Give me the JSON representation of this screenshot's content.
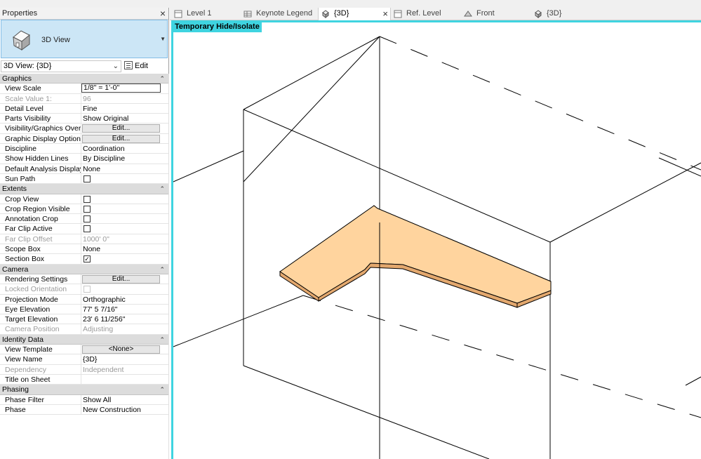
{
  "panel": {
    "title": "Properties",
    "close": "×",
    "type_name": "3D View",
    "view_selector": "3D View: {3D}",
    "edit_type": "Edit Type"
  },
  "groups": [
    {
      "label": "Graphics",
      "rows": [
        {
          "name": "View Scale",
          "value": "1/8\" = 1'-0\"",
          "kind": "boxed"
        },
        {
          "name": "Scale Value    1:",
          "value": "96",
          "kind": "dim"
        },
        {
          "name": "Detail Level",
          "value": "Fine"
        },
        {
          "name": "Parts Visibility",
          "value": "Show Original"
        },
        {
          "name": "Visibility/Graphics Over...",
          "value": "Edit...",
          "kind": "button"
        },
        {
          "name": "Graphic Display Options",
          "value": "Edit...",
          "kind": "button"
        },
        {
          "name": "Discipline",
          "value": "Coordination"
        },
        {
          "name": "Show Hidden Lines",
          "value": "By Discipline"
        },
        {
          "name": "Default Analysis Display...",
          "value": "None"
        },
        {
          "name": "Sun Path",
          "value": "",
          "kind": "checkbox",
          "checked": false
        }
      ]
    },
    {
      "label": "Extents",
      "rows": [
        {
          "name": "Crop View",
          "value": "",
          "kind": "checkbox",
          "checked": false
        },
        {
          "name": "Crop Region Visible",
          "value": "",
          "kind": "checkbox",
          "checked": false
        },
        {
          "name": "Annotation Crop",
          "value": "",
          "kind": "checkbox",
          "checked": false
        },
        {
          "name": "Far Clip Active",
          "value": "",
          "kind": "checkbox",
          "checked": false
        },
        {
          "name": "Far Clip Offset",
          "value": "1000'  0\"",
          "kind": "dim"
        },
        {
          "name": "Scope Box",
          "value": "None"
        },
        {
          "name": "Section Box",
          "value": "",
          "kind": "checkbox",
          "checked": true
        }
      ]
    },
    {
      "label": "Camera",
      "rows": [
        {
          "name": "Rendering Settings",
          "value": "Edit...",
          "kind": "button"
        },
        {
          "name": "Locked Orientation",
          "value": "",
          "kind": "checkbox-dim",
          "checked": false
        },
        {
          "name": "Projection Mode",
          "value": "Orthographic"
        },
        {
          "name": "Eye Elevation",
          "value": "77'  5 7/16\""
        },
        {
          "name": "Target Elevation",
          "value": "23'  6 11/256\""
        },
        {
          "name": "Camera Position",
          "value": "Adjusting",
          "kind": "dim"
        }
      ]
    },
    {
      "label": "Identity Data",
      "rows": [
        {
          "name": "View Template",
          "value": "<None>",
          "kind": "button"
        },
        {
          "name": "View Name",
          "value": "{3D}"
        },
        {
          "name": "Dependency",
          "value": "Independent",
          "kind": "dim"
        },
        {
          "name": "Title on Sheet",
          "value": ""
        }
      ]
    },
    {
      "label": "Phasing",
      "rows": [
        {
          "name": "Phase Filter",
          "value": "Show All"
        },
        {
          "name": "Phase",
          "value": "New Construction"
        }
      ]
    }
  ],
  "tabs": [
    {
      "label": "Level 1",
      "icon": "plan-view-icon",
      "active": false
    },
    {
      "label": "Keynote Legend",
      "icon": "schedule-icon",
      "active": false
    },
    {
      "label": "{3D}",
      "icon": "3d-view-icon",
      "active": true
    },
    {
      "label": "Ref. Level",
      "icon": "plan-view-icon",
      "active": false
    },
    {
      "label": "Front",
      "icon": "elevation-icon",
      "active": false
    },
    {
      "label": "{3D}",
      "icon": "3d-view-icon",
      "active": false
    }
  ],
  "canvas": {
    "mode_label": "Temporary Hide/Isolate",
    "frame_color": "#3fd4e0",
    "countertop_top_color": "#ffd49e",
    "countertop_edge_color": "#e3a86e",
    "countertop_back_color": "#5a4230"
  }
}
